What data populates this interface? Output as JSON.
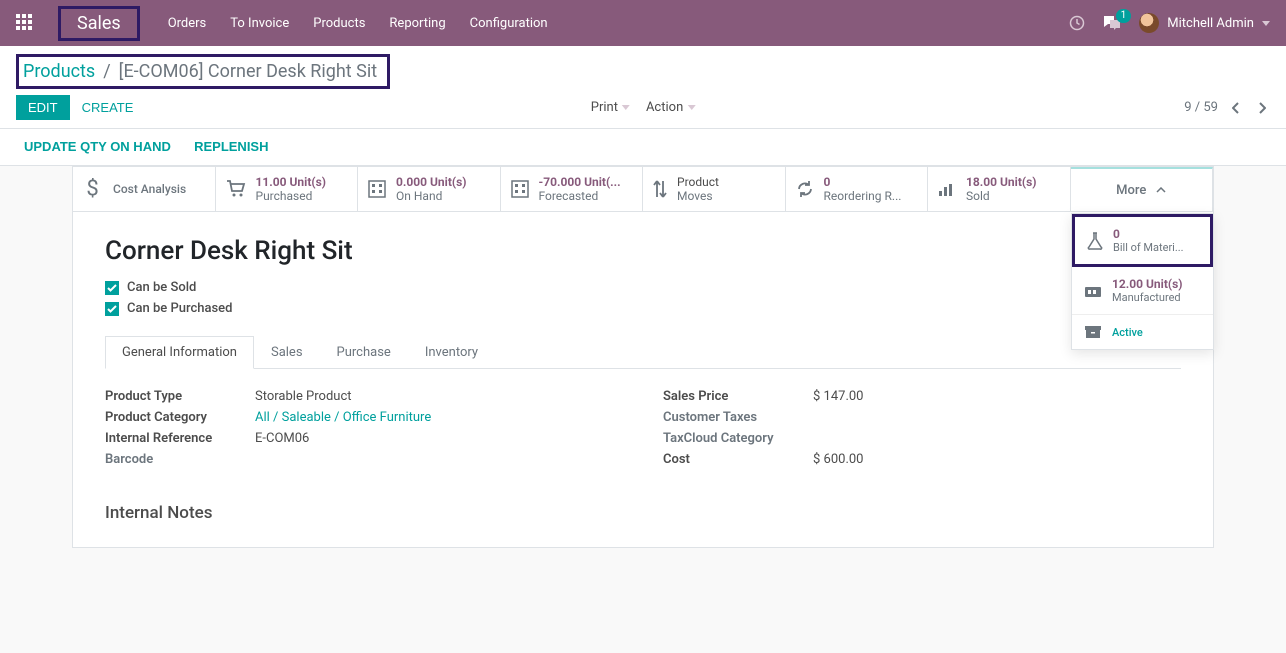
{
  "topbar": {
    "brand": "Sales",
    "nav": [
      "Orders",
      "To Invoice",
      "Products",
      "Reporting",
      "Configuration"
    ],
    "chat_badge": "1",
    "user": "Mitchell Admin"
  },
  "breadcrumb": {
    "root": "Products",
    "current": "[E-COM06] Corner Desk Right Sit"
  },
  "buttons": {
    "edit": "EDIT",
    "create": "CREATE",
    "print": "Print",
    "action": "Action",
    "update_qty": "UPDATE QTY ON HAND",
    "replenish": "REPLENISH"
  },
  "pager": {
    "pos": "9",
    "total": "59"
  },
  "stats": {
    "cost_analysis": "Cost Analysis",
    "purchased_v": "11.00 Unit(s)",
    "purchased_l": "Purchased",
    "onhand_v": "0.000 Unit(s)",
    "onhand_l": "On Hand",
    "forecast_v": "-70.000 Unit(...",
    "forecast_l": "Forecasted",
    "moves_v": "Product",
    "moves_l": "Moves",
    "reorder_v": "0",
    "reorder_l": "Reordering R...",
    "sold_v": "18.00 Unit(s)",
    "sold_l": "Sold",
    "more": "More"
  },
  "more_menu": {
    "bom_v": "0",
    "bom_l": "Bill of Materi...",
    "mfg_v": "12.00 Unit(s)",
    "mfg_l": "Manufactured",
    "active": "Active"
  },
  "product": {
    "title": "Corner Desk Right Sit",
    "can_be_sold": "Can be Sold",
    "can_be_purchased": "Can be Purchased"
  },
  "tabs": [
    "General Information",
    "Sales",
    "Purchase",
    "Inventory"
  ],
  "fields": {
    "product_type_l": "Product Type",
    "product_type_v": "Storable Product",
    "category_l": "Product Category",
    "category_v": "All / Saleable / Office Furniture",
    "internal_ref_l": "Internal Reference",
    "internal_ref_v": "E-COM06",
    "barcode_l": "Barcode",
    "sales_price_l": "Sales Price",
    "sales_price_v": "$ 147.00",
    "cust_tax_l": "Customer Taxes",
    "taxcloud_l": "TaxCloud Category",
    "cost_l": "Cost",
    "cost_v": "$ 600.00"
  },
  "notes_h": "Internal Notes"
}
